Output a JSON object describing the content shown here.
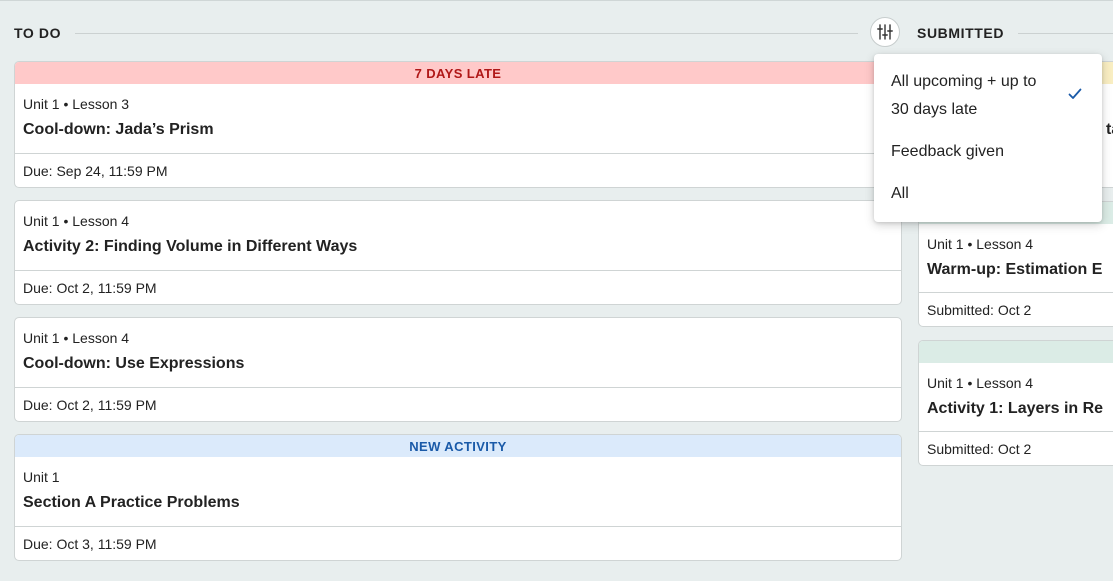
{
  "todo": {
    "title": "TO DO",
    "cards": [
      {
        "banner": "7 DAYS LATE",
        "unit": "Unit 1 • Lesson 3",
        "name": "Cool-down: Jada’s Prism",
        "due": "Due: Sep 24, 11:59 PM"
      },
      {
        "unit": "Unit 1 • Lesson 4",
        "name": "Activity 2: Finding Volume in Different Ways",
        "due": "Due: Oct 2, 11:59 PM"
      },
      {
        "unit": "Unit 1 • Lesson 4",
        "name": "Cool-down: Use Expressions",
        "due": "Due: Oct 2, 11:59 PM"
      },
      {
        "banner": "NEW ACTIVITY",
        "unit": "Unit 1",
        "name": "Section A Practice Problems",
        "due": "Due: Oct 3, 11:59 PM"
      }
    ]
  },
  "submitted": {
    "title": "SUBMITTED",
    "cards": [
      {
        "name": "ta"
      },
      {
        "unit": "Unit 1 • Lesson 4",
        "name": "Warm-up: Estimation E",
        "due": "Submitted: Oct 2"
      },
      {
        "unit": "Unit 1 • Lesson 4",
        "name": "Activity 1: Layers in Re",
        "due": "Submitted: Oct 2"
      }
    ]
  },
  "filter": {
    "icon": "sliders-icon",
    "options": [
      {
        "line1": "All upcoming + up to",
        "line2": "30 days late",
        "selected": true
      },
      {
        "label": "Feedback given",
        "selected": false
      },
      {
        "label": "All",
        "selected": false
      }
    ]
  },
  "colors": {
    "late_banner": "#ffc9c9",
    "late_text": "#b01818",
    "new_banner": "#dbeafb",
    "new_text": "#1a5aa8",
    "check": "#1a5aa8",
    "background": "#e8eeee"
  }
}
